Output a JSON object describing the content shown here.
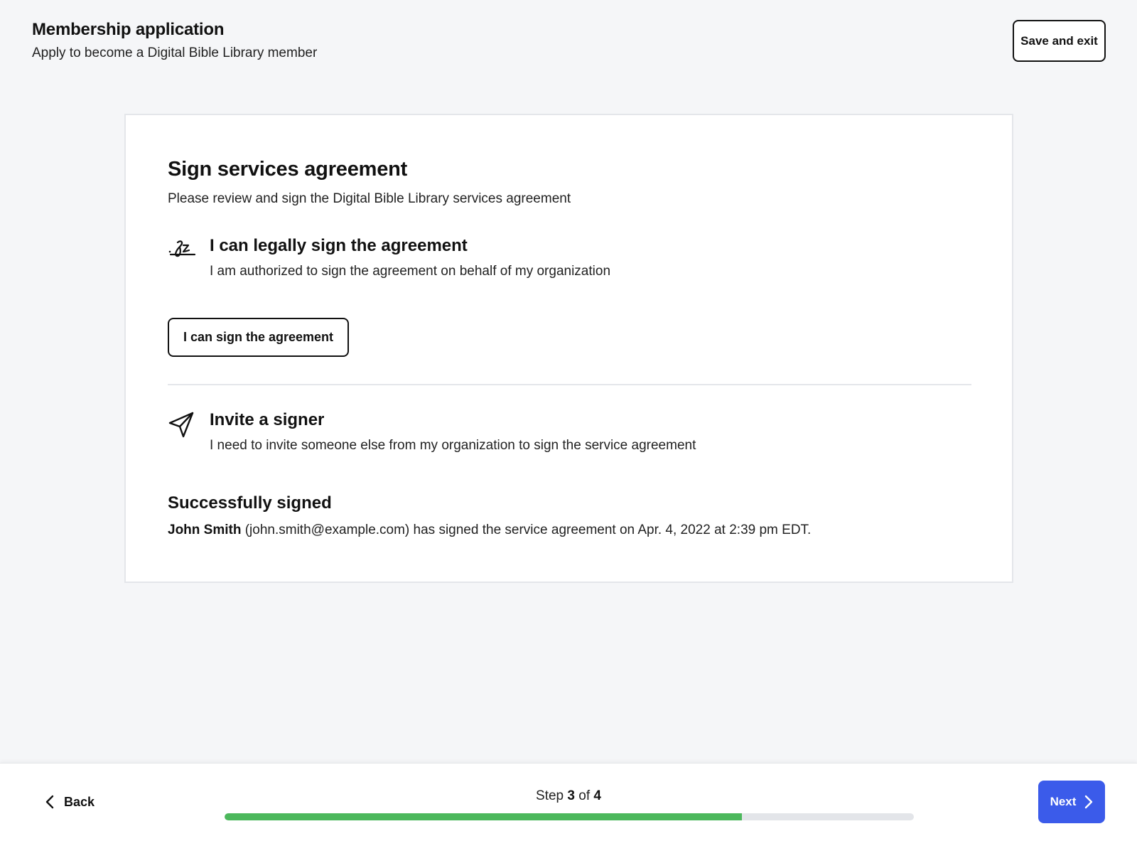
{
  "header": {
    "title": "Membership application",
    "subtitle": "Apply to become a Digital Bible Library member",
    "save_exit_label": "Save and exit"
  },
  "card": {
    "title": "Sign services agreement",
    "description": "Please review and sign the Digital Bible Library services agreement",
    "option_sign": {
      "icon": "signature-icon",
      "title": "I can legally sign the agreement",
      "text": "I am authorized to sign the agreement on behalf of my organization",
      "button_label": "I can sign the agreement"
    },
    "option_invite": {
      "icon": "paper-plane-icon",
      "title": "Invite a signer",
      "text": "I need to invite someone else from my organization to sign the service agreement"
    },
    "success": {
      "title": "Successfully signed",
      "signer_name": "John Smith",
      "message": "(john.smith@example.com) has signed the service agreement on Apr. 4, 2022 at 2:39 pm EDT."
    }
  },
  "footer": {
    "back_label": "Back",
    "step_prefix": "Step",
    "step_current": "3",
    "step_of": "of",
    "step_total": "4",
    "progress_fraction": 0.75,
    "next_label": "Next"
  },
  "colors": {
    "accent": "#3b5bea",
    "progress": "#4cb85c",
    "track": "#e3e5e9",
    "background": "#f5f6f8"
  }
}
